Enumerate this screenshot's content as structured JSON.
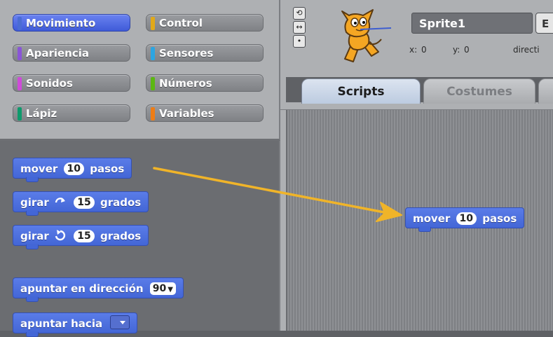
{
  "categories": [
    {
      "label": "Movimiento",
      "color": "#4a6cd4",
      "active": true
    },
    {
      "label": "Control",
      "color": "#e1a91a",
      "active": false
    },
    {
      "label": "Apariencia",
      "color": "#8a55d7",
      "active": false
    },
    {
      "label": "Sensores",
      "color": "#2ca5e2",
      "active": false
    },
    {
      "label": "Sonidos",
      "color": "#cf4ad9",
      "active": false
    },
    {
      "label": "Números",
      "color": "#5cb712",
      "active": false
    },
    {
      "label": "Lápiz",
      "color": "#0e9a6c",
      "active": false
    },
    {
      "label": "Variables",
      "color": "#ee7d16",
      "active": false
    }
  ],
  "palette_blocks": {
    "move": {
      "prefix": "mover",
      "value": "10",
      "suffix": "pasos"
    },
    "turn_right": {
      "prefix": "girar",
      "value": "15",
      "suffix": "grados",
      "icon": "rotate-clockwise-icon"
    },
    "turn_left": {
      "prefix": "girar",
      "value": "15",
      "suffix": "grados",
      "icon": "rotate-counterclockwise-icon"
    },
    "point_direction": {
      "prefix": "apuntar en dirección",
      "value": "90"
    },
    "point_towards": {
      "prefix": "apuntar hacia"
    }
  },
  "sprite": {
    "name": "Sprite1",
    "edit_label": "E",
    "x_label": "x:",
    "x_value": "0",
    "y_label": "y:",
    "y_value": "0",
    "direction_label": "directi"
  },
  "tabs": {
    "scripts": "Scripts",
    "costumes": "Costumes"
  },
  "script_block": {
    "prefix": "mover",
    "value": "10",
    "suffix": "pasos"
  },
  "colors": {
    "motion_block": "#4a6cd4",
    "arrow": "#f0b429",
    "active_category": "#4a6cd4"
  }
}
